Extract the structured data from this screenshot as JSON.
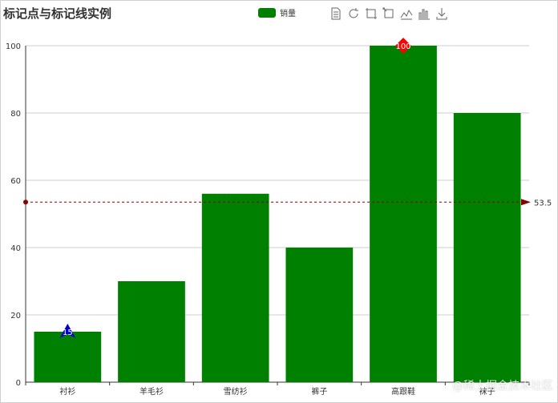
{
  "title": "标记点与标记线实例",
  "legend": {
    "label": "销量",
    "color": "#008000"
  },
  "toolbox": {
    "icons": [
      "data-view-icon",
      "restore-icon",
      "zoom-icon",
      "zoom-reset-icon",
      "line-chart-icon",
      "bar-chart-icon",
      "download-icon"
    ]
  },
  "chart_data": {
    "type": "bar",
    "categories": [
      "衬衫",
      "羊毛衫",
      "雪纺衫",
      "裤子",
      "高跟鞋",
      "袜子"
    ],
    "series": [
      {
        "name": "销量",
        "values": [
          15,
          30,
          56,
          40,
          100,
          80
        ],
        "color": "#008000"
      }
    ],
    "ylim": [
      0,
      100
    ],
    "yticks": [
      0,
      20,
      40,
      60,
      80,
      100
    ],
    "grid": true,
    "mark_points": [
      {
        "type": "min",
        "category": "衬衫",
        "value": 15,
        "label": "15",
        "color": "#0000cc"
      },
      {
        "type": "max",
        "category": "高跟鞋",
        "value": 100,
        "label": "100",
        "color": "#ff0000"
      }
    ],
    "mark_line": {
      "type": "average",
      "value": 53.5,
      "label": "53.5",
      "color": "#8b0000"
    }
  },
  "watermark": "@稀土掘金技术社区"
}
